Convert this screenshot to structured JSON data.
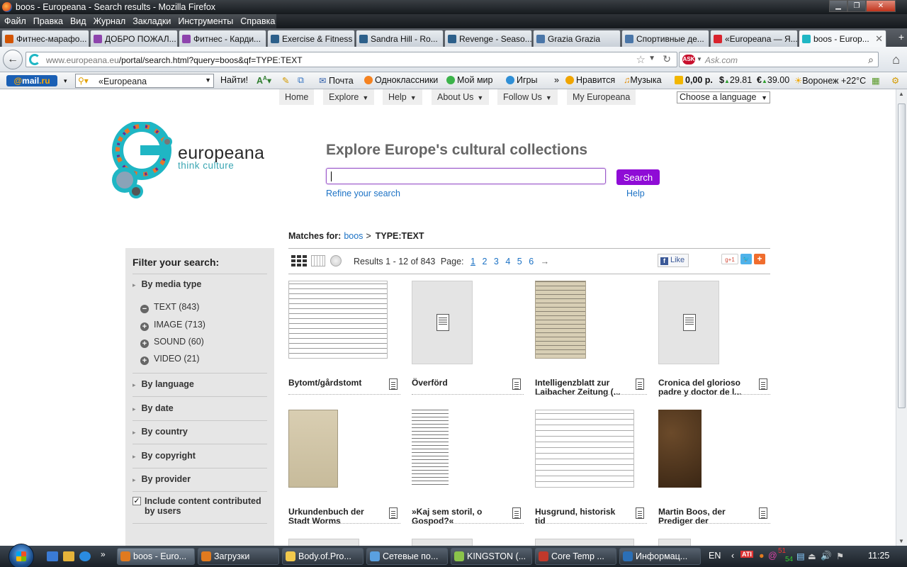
{
  "window": {
    "title": "boos - Europeana - Search results - Mozilla Firefox"
  },
  "menu": [
    "Файл",
    "Правка",
    "Вид",
    "Журнал",
    "Закладки",
    "Инструменты",
    "Справка"
  ],
  "tabs": [
    {
      "label": "Фитнес-марафо...",
      "color": "#d35400"
    },
    {
      "label": "ДОБРО ПОЖАЛ...",
      "color": "#8e44ad"
    },
    {
      "label": "Фитнес - Карди...",
      "color": "#8e44ad"
    },
    {
      "label": "Exercise & Fitness",
      "color": "#2c5f8a"
    },
    {
      "label": "Sandra Hill - Ro...",
      "color": "#2c5f8a"
    },
    {
      "label": "Revenge - Seaso...",
      "color": "#2c5f8a"
    },
    {
      "label": "Grazia Grazia",
      "color": "#4a76a8"
    },
    {
      "label": "Спортивные де...",
      "color": "#4a76a8"
    },
    {
      "label": "«Europeana — Я...",
      "color": "#d9232d"
    },
    {
      "label": "boos - Europ...",
      "color": "#1fb6c4"
    }
  ],
  "nav": {
    "url_host": "www.europeana.eu",
    "url_path": "/portal/search.html?query=boos&qf=TYPE:TEXT",
    "ask_placeholder": "Ask.com",
    "ask_logo": "ASK"
  },
  "mailbar": {
    "logo_a": "@",
    "logo_b": "mail",
    "logo_c": ".ru",
    "search_value": "«Europeana",
    "find": "Найти!",
    "items": {
      "pochta": "Почта",
      "odnoklassniki": "Одноклассники",
      "moymir": "Мой мир",
      "igry": "Игры",
      "nravitsya": "Нравится",
      "muzyka": "Музыка",
      "balance": "0,00 р.",
      "usd": "29.81",
      "eur": "39.00",
      "weather": "Воронеж +22°C"
    }
  },
  "site": {
    "topnav": [
      "Home",
      "Explore",
      "Help",
      "About Us",
      "Follow Us",
      "My Europeana"
    ],
    "language_select": "Choose a language",
    "logo_word": "europeana",
    "logo_sub": "think culture",
    "heading": "Explore Europe's cultural collections",
    "search_button": "Search",
    "refine": "Refine your search",
    "help": "Help"
  },
  "matches": {
    "label": "Matches for:",
    "query": "boos",
    "separator": ">",
    "filter": "TYPE:TEXT"
  },
  "results": {
    "summary": "Results 1 - 12 of 843",
    "page_label": "Page:",
    "pages": [
      "1",
      "2",
      "3",
      "4",
      "5",
      "6"
    ],
    "next": "→",
    "like": "Like"
  },
  "sidebar": {
    "title": "Filter your search:",
    "media_type": "By media type",
    "media_options": [
      {
        "label": "TEXT (843)",
        "sign": "−"
      },
      {
        "label": "IMAGE (713)",
        "sign": "+"
      },
      {
        "label": "SOUND (60)",
        "sign": "+"
      },
      {
        "label": "VIDEO (21)",
        "sign": "+"
      }
    ],
    "facets": [
      "By language",
      "By date",
      "By country",
      "By copyright",
      "By provider"
    ],
    "ugc_checked": true,
    "ugc_label": "Include content contributed by users"
  },
  "items": [
    {
      "title": "Bytomt/gårdstomt"
    },
    {
      "title": "Överförd"
    },
    {
      "title": "Intelligenzblatt zur Laibacher Zeitung (..."
    },
    {
      "title": "Cronica del glorioso padre y doctor de l..."
    },
    {
      "title": "Urkundenbuch der Stadt Worms"
    },
    {
      "title": "»Kaj sem storil, o Gospod?«"
    },
    {
      "title": "Husgrund, historisk tid"
    },
    {
      "title": "Martin Boos, der Prediger der"
    }
  ],
  "taskbar": {
    "buttons": [
      "boos - Euro...",
      "Загрузки",
      "Body.of.Pro...",
      "Сетевые по...",
      "KINGSTON (...",
      "Core Temp ...",
      "Информац..."
    ],
    "lang": "EN",
    "temps": [
      "51",
      "54"
    ],
    "clock": "11:25"
  }
}
